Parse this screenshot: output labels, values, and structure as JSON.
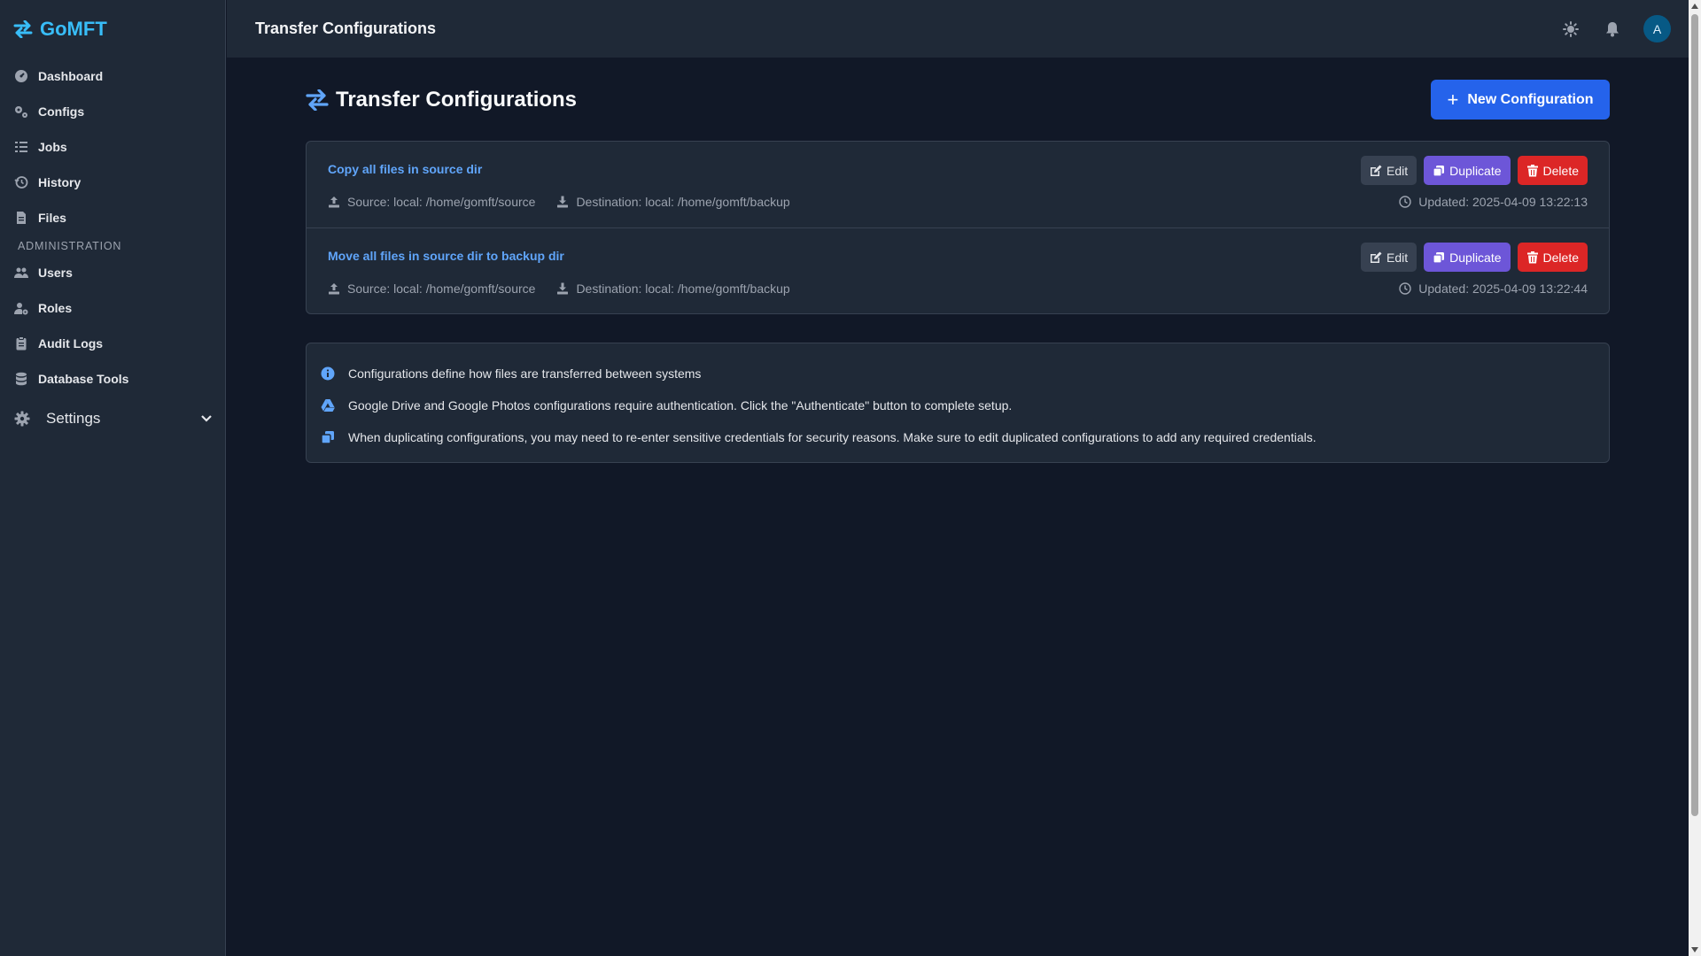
{
  "app": {
    "name": "GoMFT"
  },
  "sidebar": {
    "items": [
      {
        "label": "Dashboard",
        "icon": "dashboard-icon"
      },
      {
        "label": "Configs",
        "icon": "gears-icon"
      },
      {
        "label": "Jobs",
        "icon": "list-icon"
      },
      {
        "label": "History",
        "icon": "history-icon"
      },
      {
        "label": "Files",
        "icon": "file-icon"
      }
    ],
    "admin_section": "ADMINISTRATION",
    "admin_items": [
      {
        "label": "Users",
        "icon": "users-icon"
      },
      {
        "label": "Roles",
        "icon": "user-cog-icon"
      },
      {
        "label": "Audit Logs",
        "icon": "clipboard-icon"
      },
      {
        "label": "Database Tools",
        "icon": "database-icon"
      }
    ],
    "settings_label": "Settings"
  },
  "topbar": {
    "title": "Transfer Configurations",
    "avatar_initial": "A"
  },
  "page": {
    "title": "Transfer Configurations",
    "new_button": "New Configuration",
    "configs": [
      {
        "name": "Copy all files in source dir",
        "source": "Source: local: /home/gomft/source",
        "destination": "Destination: local: /home/gomft/backup",
        "updated": "Updated: 2025-04-09 13:22:13"
      },
      {
        "name": "Move all files in source dir to backup dir",
        "source": "Source: local: /home/gomft/source",
        "destination": "Destination: local: /home/gomft/backup",
        "updated": "Updated: 2025-04-09 13:22:44"
      }
    ],
    "buttons": {
      "edit": "Edit",
      "duplicate": "Duplicate",
      "delete": "Delete"
    },
    "info": [
      "Configurations define how files are transferred between systems",
      "Google Drive and Google Photos configurations require authentication. Click the \"Authenticate\" button to complete setup.",
      "When duplicating configurations, you may need to re-enter sensitive credentials for security reasons. Make sure to edit duplicated configurations to add any required credentials."
    ]
  },
  "colors": {
    "background": "#111827",
    "panel": "#1f2937",
    "brand": "#38bdf8",
    "primary": "#2563eb",
    "duplicate": "#6d56d8",
    "delete": "#dc2626",
    "link": "#60a5fa"
  }
}
